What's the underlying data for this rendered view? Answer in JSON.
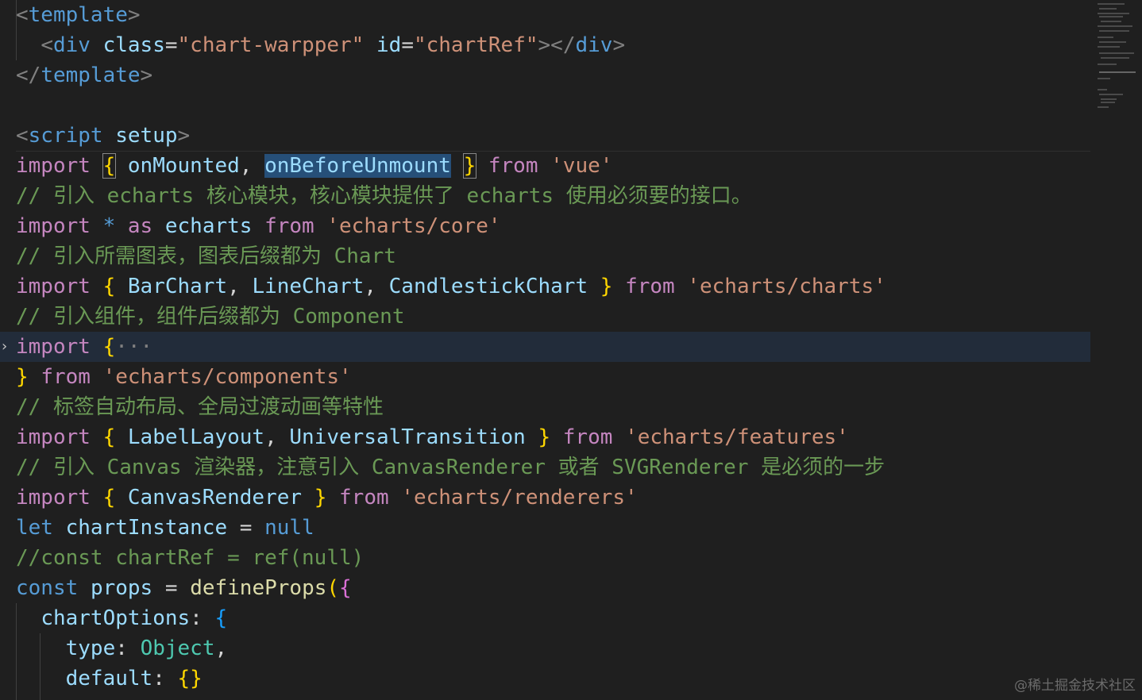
{
  "editor": {
    "lines": [
      [
        {
          "t": "<",
          "c": "tag"
        },
        {
          "t": "template",
          "c": "tagname"
        },
        {
          "t": ">",
          "c": "tag"
        }
      ],
      [
        {
          "t": "  ",
          "c": "plain"
        },
        {
          "t": "<",
          "c": "tag"
        },
        {
          "t": "div",
          "c": "tagname"
        },
        {
          "t": " ",
          "c": "plain"
        },
        {
          "t": "class",
          "c": "attr"
        },
        {
          "t": "=",
          "c": "punc"
        },
        {
          "t": "\"chart-warpper\"",
          "c": "str"
        },
        {
          "t": " ",
          "c": "plain"
        },
        {
          "t": "id",
          "c": "attr"
        },
        {
          "t": "=",
          "c": "punc"
        },
        {
          "t": "\"chartRef\"",
          "c": "str"
        },
        {
          "t": "></",
          "c": "tag"
        },
        {
          "t": "div",
          "c": "tagname"
        },
        {
          "t": ">",
          "c": "tag"
        }
      ],
      [
        {
          "t": "</",
          "c": "tag"
        },
        {
          "t": "template",
          "c": "tagname"
        },
        {
          "t": ">",
          "c": "tag"
        }
      ],
      [],
      [
        {
          "t": "<",
          "c": "tag"
        },
        {
          "t": "script",
          "c": "tagname"
        },
        {
          "t": " ",
          "c": "plain"
        },
        {
          "t": "setup",
          "c": "attr"
        },
        {
          "t": ">",
          "c": "tag"
        }
      ],
      [
        {
          "t": "import",
          "c": "kw"
        },
        {
          "t": " ",
          "c": "plain"
        },
        {
          "t": "{",
          "c": "br1",
          "box": true
        },
        {
          "t": " ",
          "c": "plain"
        },
        {
          "t": "onMounted",
          "c": "var"
        },
        {
          "t": ", ",
          "c": "punc"
        },
        {
          "t": "onBeforeUnmount",
          "c": "var",
          "sel": true
        },
        {
          "t": " ",
          "c": "plain"
        },
        {
          "t": "}",
          "c": "br1",
          "box": true
        },
        {
          "t": " ",
          "c": "plain"
        },
        {
          "t": "from",
          "c": "kw"
        },
        {
          "t": " ",
          "c": "plain"
        },
        {
          "t": "'vue'",
          "c": "str"
        }
      ],
      [
        {
          "t": "// 引入 echarts 核心模块，核心模块提供了 echarts 使用必须要的接口。",
          "c": "cmt"
        }
      ],
      [
        {
          "t": "import",
          "c": "kw"
        },
        {
          "t": " ",
          "c": "plain"
        },
        {
          "t": "*",
          "c": "decl"
        },
        {
          "t": " ",
          "c": "plain"
        },
        {
          "t": "as",
          "c": "kw"
        },
        {
          "t": " ",
          "c": "plain"
        },
        {
          "t": "echarts",
          "c": "var"
        },
        {
          "t": " ",
          "c": "plain"
        },
        {
          "t": "from",
          "c": "kw"
        },
        {
          "t": " ",
          "c": "plain"
        },
        {
          "t": "'echarts/core'",
          "c": "str"
        }
      ],
      [
        {
          "t": "// 引入所需图表，图表后缀都为 Chart",
          "c": "cmt"
        }
      ],
      [
        {
          "t": "import",
          "c": "kw"
        },
        {
          "t": " ",
          "c": "plain"
        },
        {
          "t": "{",
          "c": "br1"
        },
        {
          "t": " ",
          "c": "plain"
        },
        {
          "t": "BarChart",
          "c": "var"
        },
        {
          "t": ", ",
          "c": "punc"
        },
        {
          "t": "LineChart",
          "c": "var"
        },
        {
          "t": ", ",
          "c": "punc"
        },
        {
          "t": "CandlestickChart",
          "c": "var"
        },
        {
          "t": " ",
          "c": "plain"
        },
        {
          "t": "}",
          "c": "br1"
        },
        {
          "t": " ",
          "c": "plain"
        },
        {
          "t": "from",
          "c": "kw"
        },
        {
          "t": " ",
          "c": "plain"
        },
        {
          "t": "'echarts/charts'",
          "c": "str"
        }
      ],
      [
        {
          "t": "// 引入组件，组件后缀都为 Component",
          "c": "cmt"
        }
      ],
      [
        {
          "t": "import",
          "c": "kw"
        },
        {
          "t": " ",
          "c": "plain"
        },
        {
          "t": "{",
          "c": "br1"
        },
        {
          "t": "···",
          "c": "tag"
        }
      ],
      [
        {
          "t": "}",
          "c": "br1"
        },
        {
          "t": " ",
          "c": "plain"
        },
        {
          "t": "from",
          "c": "kw"
        },
        {
          "t": " ",
          "c": "plain"
        },
        {
          "t": "'echarts/components'",
          "c": "str"
        }
      ],
      [
        {
          "t": "// 标签自动布局、全局过渡动画等特性",
          "c": "cmt"
        }
      ],
      [
        {
          "t": "import",
          "c": "kw"
        },
        {
          "t": " ",
          "c": "plain"
        },
        {
          "t": "{",
          "c": "br1"
        },
        {
          "t": " ",
          "c": "plain"
        },
        {
          "t": "LabelLayout",
          "c": "var"
        },
        {
          "t": ", ",
          "c": "punc"
        },
        {
          "t": "UniversalTransition",
          "c": "var"
        },
        {
          "t": " ",
          "c": "plain"
        },
        {
          "t": "}",
          "c": "br1"
        },
        {
          "t": " ",
          "c": "plain"
        },
        {
          "t": "from",
          "c": "kw"
        },
        {
          "t": " ",
          "c": "plain"
        },
        {
          "t": "'echarts/features'",
          "c": "str"
        }
      ],
      [
        {
          "t": "// 引入 Canvas 渲染器，注意引入 CanvasRenderer 或者 SVGRenderer 是必须的一步",
          "c": "cmt"
        }
      ],
      [
        {
          "t": "import",
          "c": "kw"
        },
        {
          "t": " ",
          "c": "plain"
        },
        {
          "t": "{",
          "c": "br1"
        },
        {
          "t": " ",
          "c": "plain"
        },
        {
          "t": "CanvasRenderer",
          "c": "var"
        },
        {
          "t": " ",
          "c": "plain"
        },
        {
          "t": "}",
          "c": "br1"
        },
        {
          "t": " ",
          "c": "plain"
        },
        {
          "t": "from",
          "c": "kw"
        },
        {
          "t": " ",
          "c": "plain"
        },
        {
          "t": "'echarts/renderers'",
          "c": "str"
        }
      ],
      [
        {
          "t": "let",
          "c": "decl"
        },
        {
          "t": " ",
          "c": "plain"
        },
        {
          "t": "chartInstance",
          "c": "var"
        },
        {
          "t": " ",
          "c": "plain"
        },
        {
          "t": "=",
          "c": "punc"
        },
        {
          "t": " ",
          "c": "plain"
        },
        {
          "t": "null",
          "c": "decl"
        }
      ],
      [
        {
          "t": "//const chartRef = ref(null)",
          "c": "cmt"
        }
      ],
      [
        {
          "t": "const",
          "c": "decl"
        },
        {
          "t": " ",
          "c": "plain"
        },
        {
          "t": "props",
          "c": "var"
        },
        {
          "t": " ",
          "c": "plain"
        },
        {
          "t": "=",
          "c": "punc"
        },
        {
          "t": " ",
          "c": "plain"
        },
        {
          "t": "defineProps",
          "c": "fn"
        },
        {
          "t": "(",
          "c": "br1"
        },
        {
          "t": "{",
          "c": "br2"
        }
      ],
      [
        {
          "t": "  ",
          "c": "plain"
        },
        {
          "t": "chartOptions",
          "c": "prop"
        },
        {
          "t": ": ",
          "c": "punc"
        },
        {
          "t": "{",
          "c": "br3"
        }
      ],
      [
        {
          "t": "    ",
          "c": "plain"
        },
        {
          "t": "type",
          "c": "prop"
        },
        {
          "t": ": ",
          "c": "punc"
        },
        {
          "t": "Object",
          "c": "cls"
        },
        {
          "t": ",",
          "c": "punc"
        }
      ],
      [
        {
          "t": "    ",
          "c": "plain"
        },
        {
          "t": "default",
          "c": "prop"
        },
        {
          "t": ": ",
          "c": "punc"
        },
        {
          "t": "{}",
          "c": "br1"
        }
      ]
    ]
  },
  "watermark": "@稀土掘金技术社区",
  "colors": {
    "background": "#1f1f1f",
    "current_line": "#222c3a",
    "selection": "#264f78"
  }
}
